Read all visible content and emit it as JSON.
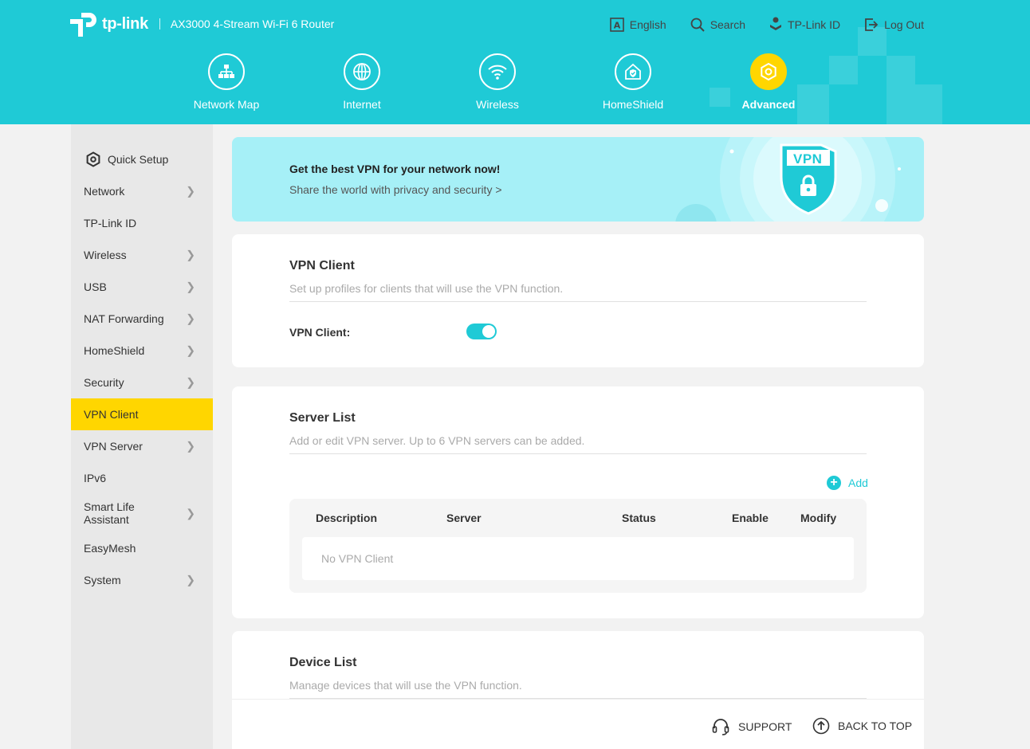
{
  "header": {
    "logo_text": "tp-link",
    "model": "AX3000 4-Stream Wi-Fi 6 Router",
    "links": [
      {
        "label": "English",
        "icon": "language-icon"
      },
      {
        "label": "Search",
        "icon": "search-icon"
      },
      {
        "label": "TP-Link ID",
        "icon": "user-id-icon"
      },
      {
        "label": "Log Out",
        "icon": "logout-icon"
      }
    ],
    "nav": [
      {
        "label": "Network Map",
        "icon": "network-map-icon"
      },
      {
        "label": "Internet",
        "icon": "globe-icon"
      },
      {
        "label": "Wireless",
        "icon": "wifi-icon"
      },
      {
        "label": "HomeShield",
        "icon": "homeshield-icon"
      },
      {
        "label": "Advanced",
        "icon": "gear-icon",
        "active": true
      }
    ]
  },
  "sidebar": {
    "items": [
      {
        "label": "Quick Setup",
        "icon": "quick-setup-icon"
      },
      {
        "label": "Network",
        "expandable": true
      },
      {
        "label": "TP-Link ID"
      },
      {
        "label": "Wireless",
        "expandable": true
      },
      {
        "label": "USB",
        "expandable": true
      },
      {
        "label": "NAT Forwarding",
        "expandable": true
      },
      {
        "label": "HomeShield",
        "expandable": true
      },
      {
        "label": "Security",
        "expandable": true
      },
      {
        "label": "VPN Client",
        "active": true
      },
      {
        "label": "VPN Server",
        "expandable": true
      },
      {
        "label": "IPv6"
      },
      {
        "label": "Smart Life\nAssistant",
        "expandable": true
      },
      {
        "label": "EasyMesh"
      },
      {
        "label": "System",
        "expandable": true
      }
    ]
  },
  "banner": {
    "title": "Get the best VPN for your network now!",
    "subtitle": "Share the world with privacy and security >",
    "badge": "VPN"
  },
  "vpn_client": {
    "title": "VPN Client",
    "description": "Set up profiles for clients that will use the VPN function.",
    "toggle_label": "VPN Client:",
    "toggle_on": true
  },
  "server_list": {
    "title": "Server List",
    "description": "Add or edit VPN server. Up to 6 VPN servers can be added.",
    "add_label": "Add",
    "columns": [
      "Description",
      "Server",
      "Status",
      "Enable",
      "Modify"
    ],
    "empty_text": "No VPN Client"
  },
  "device_list": {
    "title": "Device List",
    "description": "Manage devices that will use the VPN function."
  },
  "footer": {
    "support": "SUPPORT",
    "back_to_top": "BACK TO TOP"
  },
  "colors": {
    "header": "#1fcad6",
    "accent_yellow": "#ffd600",
    "banner": "#a6f0f7"
  }
}
